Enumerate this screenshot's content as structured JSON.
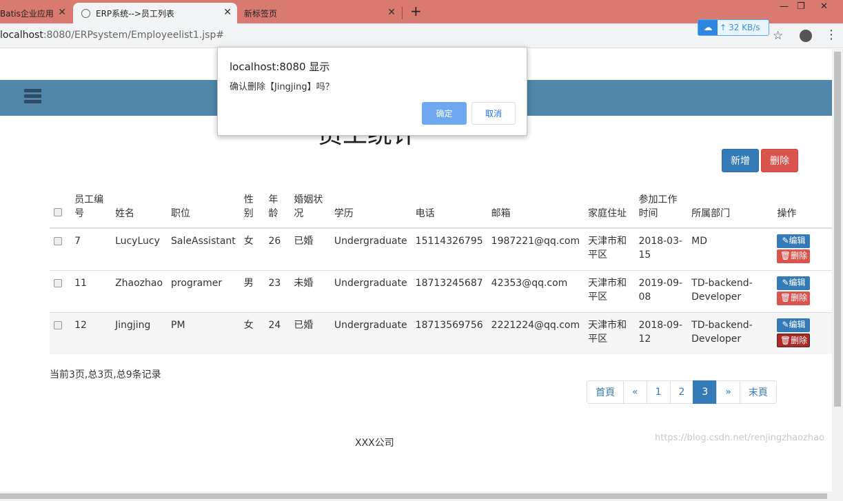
{
  "browser": {
    "tabs": [
      {
        "label": "Batis企业应用"
      },
      {
        "label": "ERP系统-->员工列表"
      },
      {
        "label": "新标签页"
      }
    ],
    "url_host": "localhost",
    "url_rest": ":8080/ERPsystem/Employeelist1.jsp#",
    "speed_label": "32 KB/s"
  },
  "page": {
    "title": "员工统计",
    "add_label": "新增",
    "delete_label": "删除",
    "headers": [
      "员工编号",
      "姓名",
      "职位",
      "性别",
      "年龄",
      "婚姻状况",
      "学历",
      "电话",
      "邮箱",
      "家庭住址",
      "参加工作时间",
      "所属部门",
      "操作"
    ],
    "rows": [
      {
        "id": "7",
        "name": "LucyLucy",
        "position": "SaleAssistant",
        "gender": "女",
        "age": "26",
        "marital": "已婚",
        "education": "Undergraduate",
        "phone": "15114326795",
        "email": "1987221@qq.com",
        "address": "天津市和平区",
        "start_date": "2018-03-15",
        "department": "MD"
      },
      {
        "id": "11",
        "name": "Zhaozhao",
        "position": "programer",
        "gender": "男",
        "age": "23",
        "marital": "未婚",
        "education": "Undergraduate",
        "phone": "18713245687",
        "email": "42353@qq.com",
        "address": "天津市和平区",
        "start_date": "2019-09-08",
        "department": "TD-backend-Developer"
      },
      {
        "id": "12",
        "name": "Jingjing",
        "position": "PM",
        "gender": "女",
        "age": "24",
        "marital": "已婚",
        "education": "Undergraduate",
        "phone": "18713569756",
        "email": "2221224@qq.com",
        "address": "天津市和平区",
        "start_date": "2018-09-12",
        "department": "TD-backend-Developer"
      }
    ],
    "edit_label": "编辑",
    "row_delete_label": "删除",
    "records_text": "当前3页,总3页,总9条记录",
    "pager": [
      "首頁",
      "«",
      "1",
      "2",
      "3",
      "»",
      "末頁"
    ],
    "current_page": "3",
    "footer": "XXX公司",
    "watermark": "https://blog.csdn.net/renjingzhaozhao"
  },
  "dialog": {
    "title": "localhost:8080 显示",
    "message": "确认删除【Jingjing】吗？",
    "ok_label": "确定",
    "cancel_label": "取消"
  }
}
